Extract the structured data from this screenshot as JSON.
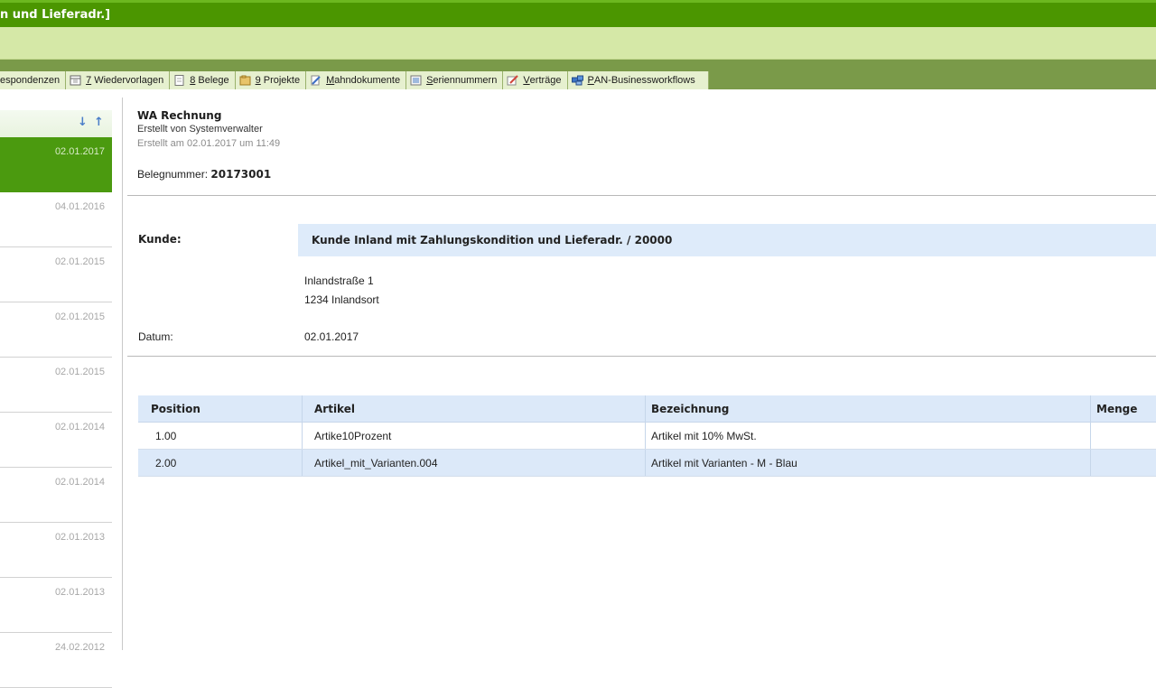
{
  "window": {
    "title": "n und Lieferadr.]"
  },
  "tabs": [
    {
      "prefix": "",
      "label": "espondenzen",
      "icon": "correspondence-icon"
    },
    {
      "prefix": "7",
      "label": "Wiedervorlagen",
      "icon": "calendar-icon"
    },
    {
      "prefix": "8",
      "label": "Belege",
      "icon": "document-icon"
    },
    {
      "prefix": "9",
      "label": "Projekte",
      "icon": "folder-icon"
    },
    {
      "prefix": "M",
      "label": "ahndokumente",
      "icon": "dunning-icon"
    },
    {
      "prefix": "S",
      "label": "eriennummern",
      "icon": "serial-numbers-icon"
    },
    {
      "prefix": "V",
      "label": "erträge",
      "icon": "contract-icon"
    },
    {
      "prefix": "P",
      "label": "AN-Businessworkflows",
      "icon": "workflow-icon"
    }
  ],
  "list": {
    "sort_down": "↓",
    "sort_up": "↑",
    "items": [
      {
        "date": "02.01.2017",
        "selected": true
      },
      {
        "date": "04.01.2016"
      },
      {
        "date": "02.01.2015"
      },
      {
        "date": "02.01.2015"
      },
      {
        "date": "02.01.2015"
      },
      {
        "date": "02.01.2014"
      },
      {
        "date": "02.01.2014"
      },
      {
        "date": "02.01.2013"
      },
      {
        "date": "02.01.2013"
      },
      {
        "date": "24.02.2012"
      }
    ]
  },
  "document": {
    "title": "WA Rechnung",
    "created_by": "Erstellt von Systemverwalter",
    "created_at": "Erstellt am 02.01.2017 um 11:49",
    "belegnummer_label": "Belegnummer:",
    "belegnummer_value": "20173001",
    "kunde_label": "Kunde:",
    "kunde_value": "Kunde Inland mit Zahlungskondition und Lieferadr. / 20000",
    "address_line1": "Inlandstraße 1",
    "address_line2": "1234 Inlandsort",
    "datum_label": "Datum:",
    "datum_value": "02.01.2017"
  },
  "table": {
    "headers": [
      "Position",
      "Artikel",
      "Bezeichnung",
      "Menge"
    ],
    "rows": [
      [
        "1.00",
        "Artike10Prozent",
        "Artikel mit 10% MwSt.",
        ""
      ],
      [
        "2.00",
        "Artikel_mit_Varianten.004",
        "Artikel mit Varianten - M - Blau",
        ""
      ]
    ]
  },
  "colors": {
    "titlebar": "#4b9600",
    "ribbon": "#d5e8a7",
    "tabbar": "#7a9a49",
    "selected_item": "#4b9a0f",
    "highlight_blue": "#deebfa"
  }
}
